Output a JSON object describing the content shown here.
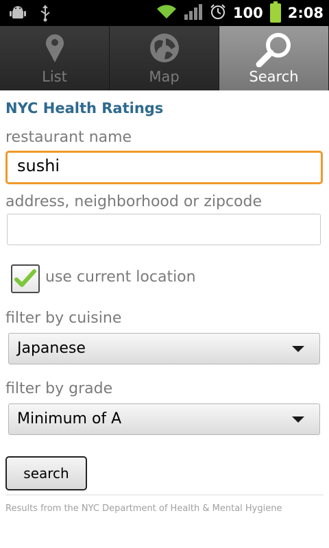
{
  "status_bar": {
    "battery_level": "100",
    "time": "2:08",
    "icons": [
      "android-debug-icon",
      "usb-icon",
      "wifi-icon",
      "signal-icon",
      "alarm-icon",
      "battery-icon"
    ],
    "battery_color": "#9fd33a"
  },
  "tabs": [
    {
      "label": "List",
      "icon": "map-pin-icon",
      "active": false
    },
    {
      "label": "Map",
      "icon": "globe-icon",
      "active": false
    },
    {
      "label": "Search",
      "icon": "magnifier-icon",
      "active": true
    }
  ],
  "form": {
    "title": "NYC Health Ratings",
    "restaurant_label": "restaurant name",
    "restaurant_value": "sushi",
    "address_label": "address, neighborhood or zipcode",
    "address_value": "",
    "use_location_label": "use current location",
    "use_location_checked": true,
    "cuisine_label": "filter by cuisine",
    "cuisine_value": "Japanese",
    "grade_label": "filter by grade",
    "grade_value": "Minimum of A",
    "search_button": "search"
  },
  "footer": {
    "text": "Results from the NYC Department of Health & Mental Hygiene"
  },
  "colors": {
    "title": "#2e6a8e",
    "focus": "#f0992a",
    "check": "#7cc63a"
  }
}
